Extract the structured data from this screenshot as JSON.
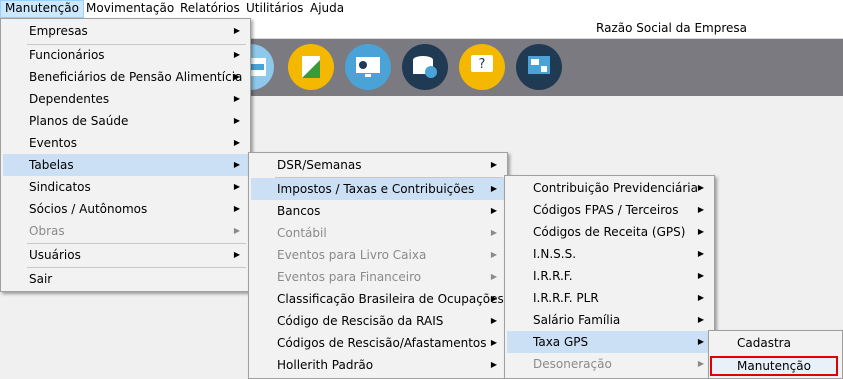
{
  "menubar": {
    "items": [
      {
        "label": "Manutenção"
      },
      {
        "label": "Movimentação"
      },
      {
        "label": "Relatórios"
      },
      {
        "label": "Utilitários"
      },
      {
        "label": "Ajuda"
      }
    ]
  },
  "company_name": "Razão Social da Empresa",
  "toolbar": {
    "buttons": [
      {
        "icon": "irrf-document-icon",
        "color": "#8ec8ea"
      },
      {
        "icon": "document-folder-icon",
        "color": "#f5b800"
      },
      {
        "icon": "monitor-arrow-icon",
        "color": "#4aa3d6"
      },
      {
        "icon": "database-arrow-icon",
        "color": "#1f3a52"
      },
      {
        "icon": "help-chat-icon",
        "color": "#f5b800"
      },
      {
        "icon": "calculator-monitor-icon",
        "color": "#1f3a52"
      }
    ]
  },
  "menu_manutencao": {
    "items": [
      {
        "label": "Empresas",
        "submenu": true
      },
      {
        "label": "Funcionários",
        "submenu": true
      },
      {
        "label": "Beneficiários de Pensão Alimentícia",
        "submenu": true
      },
      {
        "label": "Dependentes",
        "submenu": true
      },
      {
        "label": "Planos de Saúde",
        "submenu": true
      },
      {
        "label": "Eventos",
        "submenu": true
      },
      {
        "label": "Tabelas",
        "submenu": true
      },
      {
        "label": "Sindicatos",
        "submenu": true
      },
      {
        "label": "Sócios / Autônomos",
        "submenu": true
      },
      {
        "label": "Obras",
        "submenu": true
      },
      {
        "label": "Usuários",
        "submenu": true
      },
      {
        "label": "Sair",
        "submenu": false
      }
    ]
  },
  "menu_tabelas": {
    "items": [
      {
        "label": "DSR/Semanas"
      },
      {
        "label": "Impostos / Taxas e Contribuições"
      },
      {
        "label": "Bancos"
      },
      {
        "label": "Contábil"
      },
      {
        "label": "Eventos para Livro Caixa"
      },
      {
        "label": "Eventos para Financeiro"
      },
      {
        "label": "Classificação Brasileira de Ocupações"
      },
      {
        "label": "Código de Rescisão da RAIS"
      },
      {
        "label": "Códigos de Rescisão/Afastamentos"
      },
      {
        "label": "Hollerith Padrão"
      }
    ]
  },
  "menu_impostos": {
    "items": [
      {
        "label": "Contribuição Previdenciária"
      },
      {
        "label": "Códigos FPAS / Terceiros"
      },
      {
        "label": "Códigos de Receita (GPS)"
      },
      {
        "label": "I.N.S.S."
      },
      {
        "label": "I.R.R.F."
      },
      {
        "label": "I.R.R.F. PLR"
      },
      {
        "label": "Salário Família"
      },
      {
        "label": "Taxa GPS"
      },
      {
        "label": "Desoneração"
      }
    ]
  },
  "menu_taxa_gps": {
    "items": [
      {
        "label": "Cadastra"
      },
      {
        "label": "Manutenção"
      }
    ]
  },
  "arrow_glyph": "▶"
}
